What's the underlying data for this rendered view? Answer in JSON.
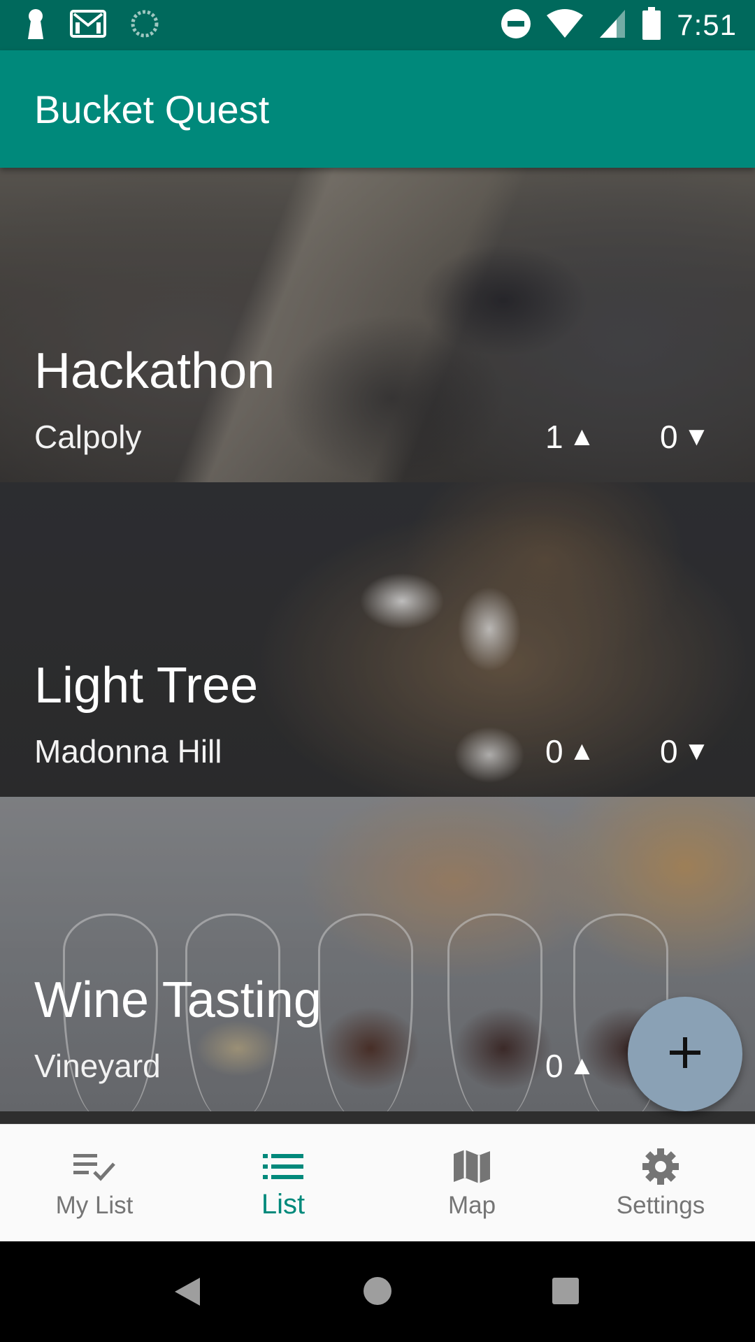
{
  "status_bar": {
    "time": "7:51",
    "left_icons": [
      "keyhole-notification-icon",
      "gmail-icon",
      "sync-icon"
    ],
    "right_icons": [
      "do-not-disturb-icon",
      "wifi-icon",
      "signal-icon",
      "battery-icon"
    ]
  },
  "app_bar": {
    "title": "Bucket Quest"
  },
  "items": [
    {
      "title": "Hackathon",
      "location": "Calpoly",
      "upvotes": "1",
      "downvotes": "0"
    },
    {
      "title": "Light Tree",
      "location": "Madonna Hill",
      "upvotes": "0",
      "downvotes": "0"
    },
    {
      "title": "Wine Tasting",
      "location": "Vineyard",
      "upvotes": "0"
    }
  ],
  "vote_symbols": {
    "up": "▲",
    "down": "▼"
  },
  "fab": {
    "icon": "plus-icon"
  },
  "bottom_nav": {
    "active": "List",
    "items": [
      {
        "label": "My List",
        "icon": "playlist-check-icon"
      },
      {
        "label": "List",
        "icon": "list-icon"
      },
      {
        "label": "Map",
        "icon": "map-icon"
      },
      {
        "label": "Settings",
        "icon": "gear-icon"
      }
    ]
  },
  "colors": {
    "primary": "#00897b",
    "primary_dark": "#00695c",
    "fab": "#8aa1b5",
    "nav_inactive": "#757575"
  }
}
